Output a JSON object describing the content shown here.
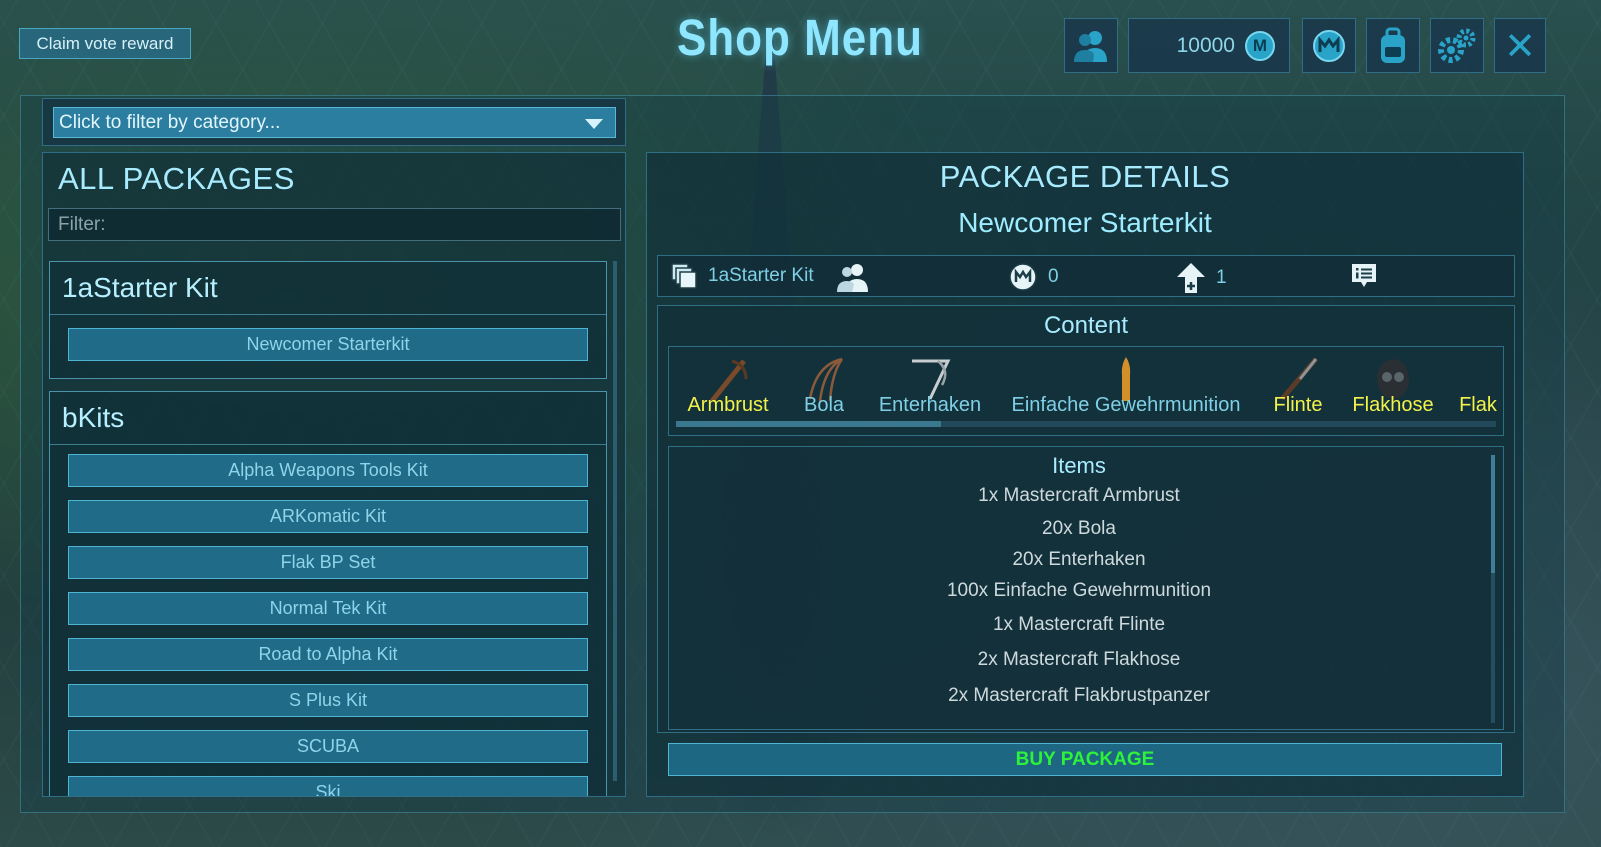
{
  "header": {
    "vote_label": "Claim vote reward",
    "title": "Shop Menu",
    "currency": "10000",
    "coin_symbol": "M",
    "close_symbol": "✕"
  },
  "left": {
    "category_placeholder": "Click to filter by category...",
    "title": "ALL PACKAGES",
    "filter_placeholder": "Filter:",
    "groups": [
      {
        "name": "1aStarter Kit",
        "items": [
          "Newcomer Starterkit"
        ]
      },
      {
        "name": "bKits",
        "items": [
          "Alpha Weapons Tools Kit",
          "ARKomatic Kit",
          "Flak BP Set",
          "Normal Tek Kit",
          "Road to Alpha Kit",
          "S Plus Kit",
          "SCUBA",
          "Ski"
        ]
      }
    ]
  },
  "right": {
    "title": "PACKAGE DETAILS",
    "package_name": "Newcomer Starterkit",
    "info": {
      "category": "1aStarter Kit",
      "price": "0",
      "level": "1"
    },
    "content_title": "Content",
    "strip": [
      {
        "name": "Armbrust",
        "color": "#f2f24a"
      },
      {
        "name": "Bola",
        "color": "#7fd0e6"
      },
      {
        "name": "Enterhaken",
        "color": "#7fd0e6"
      },
      {
        "name": "Einfache Gewehrmunition",
        "color": "#7fd0e6"
      },
      {
        "name": "Flinte",
        "color": "#f2f24a"
      },
      {
        "name": "Flakhose",
        "color": "#f2f24a"
      },
      {
        "name": "Flak",
        "color": "#f2f24a"
      }
    ],
    "items_title": "Items",
    "items": [
      "1x Mastercraft Armbrust",
      "20x Bola",
      "20x Enterhaken",
      "100x Einfache Gewehrmunition",
      "1x Mastercraft Flinte",
      "2x Mastercraft Flakhose",
      "2x Mastercraft Flakbrustpanzer"
    ],
    "buy_label": "BUY PACKAGE"
  }
}
